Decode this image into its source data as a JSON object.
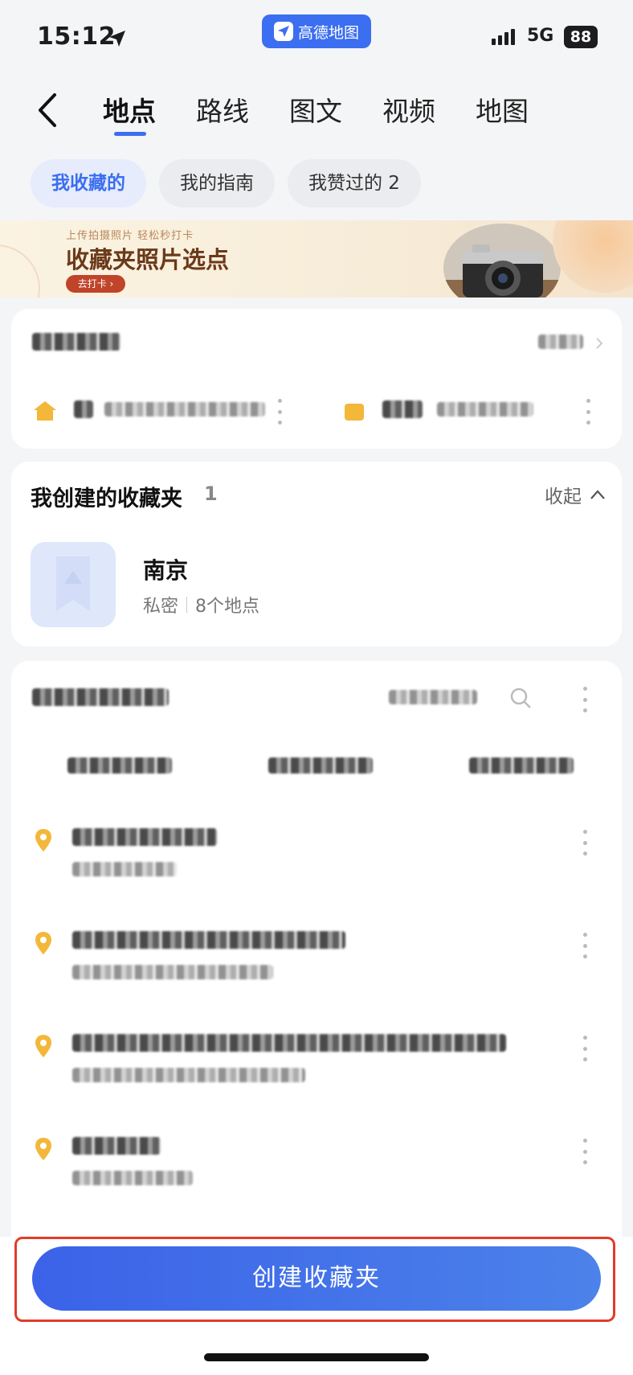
{
  "status_bar": {
    "time": "15:12",
    "app_name": "高德地图",
    "network": "5G",
    "battery": "88"
  },
  "nav": {
    "tabs": [
      {
        "label": "地点",
        "active": true
      },
      {
        "label": "路线",
        "active": false
      },
      {
        "label": "图文",
        "active": false
      },
      {
        "label": "视频",
        "active": false
      },
      {
        "label": "地图",
        "active": false
      }
    ]
  },
  "chips": [
    {
      "label": "我收藏的",
      "active": true
    },
    {
      "label": "我的指南",
      "active": false
    },
    {
      "label": "我赞过的 2",
      "active": false
    }
  ],
  "banner": {
    "subtitle": "上传拍摄照片 轻松秒打卡",
    "title": "收藏夹照片选点",
    "button": "去打卡 ›"
  },
  "folders": {
    "title": "我创建的收藏夹",
    "count": "1",
    "collapse_label": "收起",
    "items": [
      {
        "name": "南京",
        "privacy": "私密",
        "places": "8个地点"
      }
    ]
  },
  "create_button": "创建收藏夹",
  "colors": {
    "accent": "#3b6ef0",
    "highlight_frame": "#e23b2a",
    "pin": "#f3b73a"
  }
}
